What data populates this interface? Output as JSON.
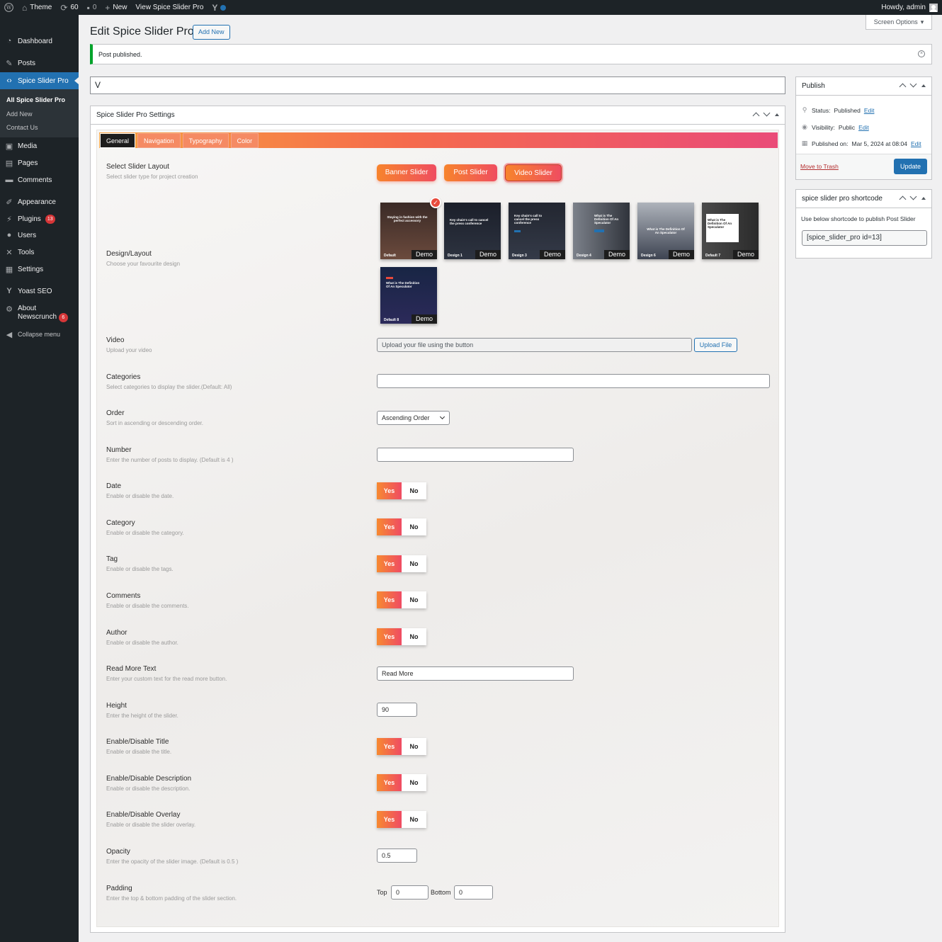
{
  "adminbar": {
    "site_name": "Theme",
    "updates_count": "60",
    "comments_count": "0",
    "new_label": "New",
    "view_label": "View Spice Slider Pro",
    "howdy": "Howdy, admin"
  },
  "sidebar": {
    "items": [
      {
        "label": "Dashboard",
        "icon": "dashboard-icon"
      },
      {
        "label": "Posts",
        "icon": "pin-icon"
      },
      {
        "label": "Spice Slider Pro",
        "icon": "code-icon"
      },
      {
        "label": "Media",
        "icon": "media-icon"
      },
      {
        "label": "Pages",
        "icon": "pages-icon"
      },
      {
        "label": "Comments",
        "icon": "comments-icon"
      },
      {
        "label": "Appearance",
        "icon": "brush-icon"
      },
      {
        "label": "Plugins",
        "icon": "plugin-icon",
        "badge": "13"
      },
      {
        "label": "Users",
        "icon": "users-icon"
      },
      {
        "label": "Tools",
        "icon": "wrench-icon"
      },
      {
        "label": "Settings",
        "icon": "settings-icon"
      },
      {
        "label": "Yoast SEO",
        "icon": "yoast-icon"
      },
      {
        "label": "About",
        "label2": "Newscrunch",
        "icon": "gear-icon",
        "badge": "6"
      },
      {
        "label": "Collapse menu",
        "icon": "collapse-icon"
      }
    ],
    "submenu": [
      "All Spice Slider Pro",
      "Add New",
      "Contact Us"
    ]
  },
  "header": {
    "title": "Edit Spice Slider Pro",
    "add_new": "Add New",
    "screen_options": "Screen Options"
  },
  "notice": {
    "text": "Post published."
  },
  "post_title": "V",
  "settings": {
    "box_title": "Spice Slider Pro Settings",
    "tabs": [
      "General",
      "Navigation",
      "Typography",
      "Color"
    ],
    "active_tab": "General",
    "layout": {
      "label": "Select Slider Layout",
      "desc": "Select slider type for project creation",
      "buttons": [
        "Banner Slider",
        "Post Slider",
        "Video Slider"
      ],
      "selected": "Video Slider"
    },
    "design": {
      "label": "Design/Layout",
      "desc": "Choose your favourite design",
      "demo_label": "Demo",
      "check": "✓",
      "thumbs": [
        {
          "name": "Default",
          "text": "Staying in fashion with the perfect accessory"
        },
        {
          "name": "Design 1",
          "text": "Key chain's call to cancel the press conference"
        },
        {
          "name": "Design 3",
          "text": "Key chain's call to cancel the press conference"
        },
        {
          "name": "Design 4",
          "text": "What is The Definition Of An Speculator"
        },
        {
          "name": "Design 6",
          "text": "What is The Definition Of An Speculator"
        },
        {
          "name": "Default 7",
          "text": "What is The Definition Of An Speculator"
        },
        {
          "name": "Default 8",
          "text": "What is The Definition Of An Speculator"
        }
      ]
    },
    "video": {
      "label": "Video",
      "desc": "Upload your video",
      "placeholder": "Upload your file using the button",
      "button": "Upload File"
    },
    "categories": {
      "label": "Categories",
      "desc": "Select categories to display the slider.(Default: All)",
      "value": ""
    },
    "order": {
      "label": "Order",
      "desc": "Sort in ascending or descending order.",
      "value": "Ascending Order"
    },
    "number": {
      "label": "Number",
      "desc": "Enter the number of posts to display. (Default is 4 )",
      "value": ""
    },
    "toggle_yes": "Yes",
    "toggle_no": "No",
    "date": {
      "label": "Date",
      "desc": "Enable or disable the date.",
      "value": "Yes"
    },
    "category": {
      "label": "Category",
      "desc": "Enable or disable the category.",
      "value": "Yes"
    },
    "tag": {
      "label": "Tag",
      "desc": "Enable or disable the tags.",
      "value": "Yes"
    },
    "comments": {
      "label": "Comments",
      "desc": "Enable or disable the comments.",
      "value": "Yes"
    },
    "author": {
      "label": "Author",
      "desc": "Enable or disable the author.",
      "value": "Yes"
    },
    "read_more": {
      "label": "Read More Text",
      "desc": "Enter your custom text for the read more button.",
      "value": "Read More"
    },
    "height": {
      "label": "Height",
      "desc": "Enter the height of the slider.",
      "value": "90"
    },
    "title_toggle": {
      "label": "Enable/Disable Title",
      "desc": "Enable or disable the title.",
      "value": "Yes"
    },
    "desc_toggle": {
      "label": "Enable/Disable Description",
      "desc": "Enable or disable the description.",
      "value": "Yes"
    },
    "overlay_toggle": {
      "label": "Enable/Disable Overlay",
      "desc": "Enable or disable the slider overlay.",
      "value": "Yes"
    },
    "opacity": {
      "label": "Opacity",
      "desc": "Enter the opacity of the slider image. (Default is 0.5 )",
      "value": "0.5"
    },
    "padding": {
      "label": "Padding",
      "desc": "Enter the top & bottom padding of the slider section.",
      "top_label": "Top",
      "top_value": "0",
      "bottom_label": "Bottom",
      "bottom_value": "0"
    }
  },
  "publish": {
    "title": "Publish",
    "status_label": "Status:",
    "status_value": "Published",
    "visibility_label": "Visibility:",
    "visibility_value": "Public",
    "published_label": "Published on:",
    "published_value": "Mar 5, 2024 at 08:04",
    "edit": "Edit",
    "trash": "Move to Trash",
    "update": "Update"
  },
  "shortcode": {
    "title": "spice slider pro shortcode",
    "desc": "Use below shortcode to publish Post Slider",
    "value": "[spice_slider_pro id=13]"
  },
  "colors": {
    "accent": "#2271b1",
    "gradient_start": "#f7842c",
    "gradient_end": "#ef4d60",
    "sidebar_bg": "#1d2327"
  }
}
